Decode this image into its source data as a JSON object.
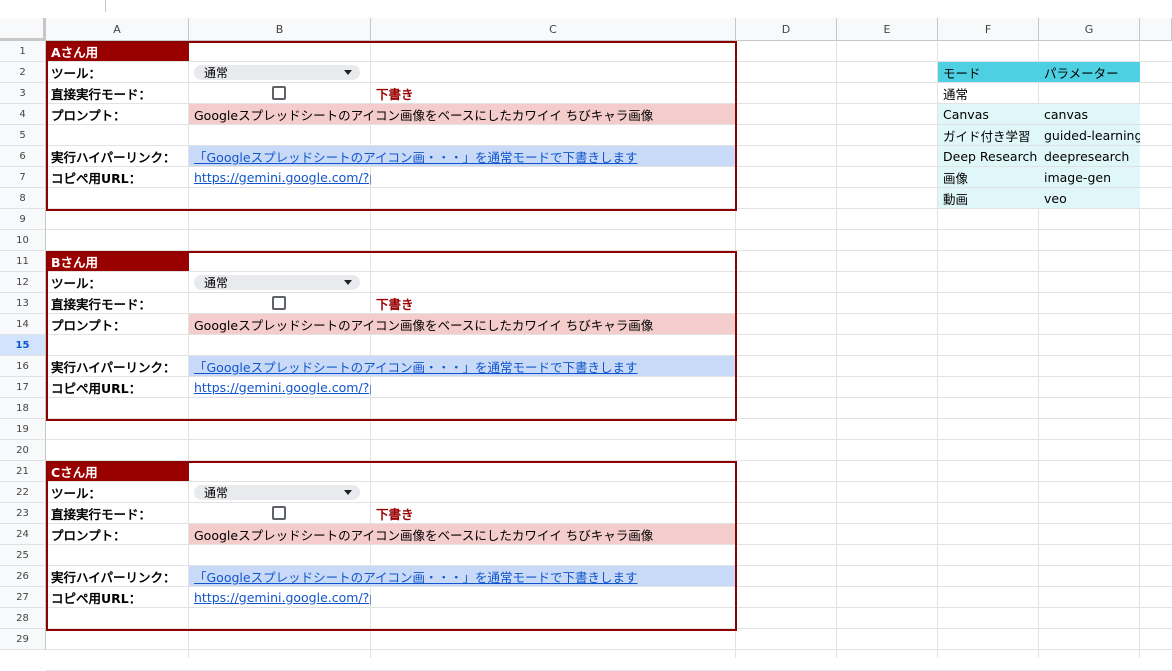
{
  "columns": [
    "A",
    "B",
    "C",
    "D",
    "E",
    "F",
    "G"
  ],
  "rows": [
    "1",
    "2",
    "3",
    "4",
    "5",
    "6",
    "7",
    "8",
    "9",
    "10",
    "11",
    "12",
    "13",
    "14",
    "15",
    "16",
    "17",
    "18",
    "19",
    "20",
    "21",
    "22",
    "23",
    "24",
    "25",
    "26",
    "27",
    "28",
    "29"
  ],
  "selected_row": "15",
  "blocks": [
    {
      "title": "Aさん用",
      "tool_label": "ツール：",
      "tool_value": "通常",
      "direct_label": "直接実行モード：",
      "draft_label": "下書き",
      "prompt_label": "プロンプト：",
      "prompt_value": "Googleスプレッドシートのアイコン画像をベースにしたカワイイ ちびキャラ画像",
      "link_label": "実行ハイパーリンク：",
      "link_value": "「Googleスプレッドシートのアイコン画・・・」を通常モードで下書きします",
      "url_label": "コピペ用URL：",
      "url_value": "https://gemini.google.com/?pro"
    },
    {
      "title": "Bさん用",
      "tool_label": "ツール：",
      "tool_value": "通常",
      "direct_label": "直接実行モード：",
      "draft_label": "下書き",
      "prompt_label": "プロンプト：",
      "prompt_value": "Googleスプレッドシートのアイコン画像をベースにしたカワイイ ちびキャラ画像",
      "link_label": "実行ハイパーリンク：",
      "link_value": "「Googleスプレッドシートのアイコン画・・・」を通常モードで下書きします",
      "url_label": "コピペ用URL：",
      "url_value": "https://gemini.google.com/?pro"
    },
    {
      "title": "Cさん用",
      "tool_label": "ツール：",
      "tool_value": "通常",
      "direct_label": "直接実行モード：",
      "draft_label": "下書き",
      "prompt_label": "プロンプト：",
      "prompt_value": "Googleスプレッドシートのアイコン画像をベースにしたカワイイ ちびキャラ画像",
      "link_label": "実行ハイパーリンク：",
      "link_value": "「Googleスプレッドシートのアイコン画・・・」を通常モードで下書きします",
      "url_label": "コピペ用URL：",
      "url_value": "https://gemini.google.com/?pro"
    }
  ],
  "mode_table": {
    "header": [
      "モード",
      "パラメーター"
    ],
    "rows": [
      [
        "通常",
        ""
      ],
      [
        "Canvas",
        "canvas"
      ],
      [
        "ガイド付き学習",
        "guided-learning"
      ],
      [
        "Deep Research",
        "deepresearch"
      ],
      [
        "画像",
        "image-gen"
      ],
      [
        "動画",
        "veo"
      ]
    ]
  },
  "colors": {
    "title_bg": "#990000",
    "prompt_bg": "#f4cccc",
    "link_bg": "#c9daf8",
    "table_header_bg": "#4dd0e1",
    "table_row_bg": "#e0f7fa"
  }
}
